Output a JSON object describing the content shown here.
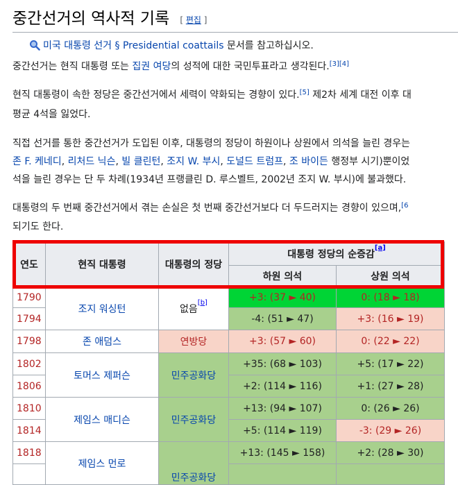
{
  "heading": {
    "title": "중간선거의 역사적 기록",
    "edit_open": "[ ",
    "edit_label": "편집",
    "edit_close": " ]"
  },
  "hatnote": {
    "icon": "search-icon",
    "link1": "미국 대통령 선거 § Presidential coattails",
    "suffix": " 문서를 참고하십시오."
  },
  "para1": {
    "t1": "중간선거는 현직 대통령 또는 ",
    "link": "집권 여당",
    "t2": "의 성적에 대한 국민투표라고 생각된다.",
    "ref1": "[3]",
    "ref2": "[4]"
  },
  "para2": {
    "line1": "현직 대통령이 속한 정당은 중간선거에서 세력이 약화되는 경향이 있다.",
    "ref": "[5]",
    "line1b": " 제2차 세계 대전 이후 대",
    "line2": "평균 4석을 잃었다."
  },
  "para3": {
    "line1": "직접 선거를 통한 중간선거가 도입된 이후, 대통령의 정당이 하원이나 상원에서 의석을 늘린 경우는",
    "l2_links": [
      "존 F. 케네디",
      "리처드 닉슨",
      "빌 클린턴",
      "조지 W. 부시",
      "도널드 트럼프",
      "조 바이든"
    ],
    "l2_sep": ", ",
    "l2_tail": " 행정부 시기)뿐이었",
    "line3": "석을 늘린 경우는 단 두 차례(1934년 프랭클린 D. 루스벨트, 2002년 조지 W. 부시)에 불과했다."
  },
  "para4": {
    "line1": "대통령의 두 번째 중간선거에서 겪는 손실은 첫 번째 중간선거보다 더 두드러지는 경향이 있으며,",
    "ref": "[6",
    "line2": "되기도 한다."
  },
  "table": {
    "headers": {
      "year": "연도",
      "president": "현직 대통령",
      "party": "대통령의 정당",
      "net": "대통령 정당의 순증감",
      "net_ref": "[a]",
      "house": "하원 의석",
      "senate": "상원 의석"
    },
    "rows": [
      {
        "year": "1790",
        "president": "조지 워싱턴",
        "party": "없음",
        "party_ref": "[b]",
        "house": "+3: (37 ► 40)",
        "senate": "0: (18 ► 18)"
      },
      {
        "year": "1794",
        "house": "-4: (51 ► 47)",
        "senate": "+3: (16 ► 19)"
      },
      {
        "year": "1798",
        "president": "존 애덤스",
        "party": "연방당",
        "house": "+3: (57 ► 60)",
        "senate": "0: (22 ► 22)"
      },
      {
        "year": "1802",
        "president": "토머스 제퍼슨",
        "party": "민주공화당",
        "house": "+35: (68 ► 103)",
        "senate": "+5: (17 ► 22)"
      },
      {
        "year": "1806",
        "house": "+2: (114 ► 116)",
        "senate": "+1: (27 ► 28)"
      },
      {
        "year": "1810",
        "president": "제임스 매디슨",
        "party": "민주공화당",
        "house": "+13: (94 ► 107)",
        "senate": "0: (26 ► 26)"
      },
      {
        "year": "1814",
        "house": "+5: (114 ► 119)",
        "senate": "-3: (29 ► 26)"
      },
      {
        "year": "1818",
        "president": "제임스 먼로",
        "party": "민주공화당",
        "house": "+13: (145 ► 158)",
        "senate": "+2: (28 ► 30)"
      }
    ]
  },
  "colors": {
    "highlight_box": "#ee0000",
    "link": "#0645ad",
    "gain_green": "#00d435",
    "light_green": "#a8d08d",
    "light_red": "#f8d4c8"
  }
}
